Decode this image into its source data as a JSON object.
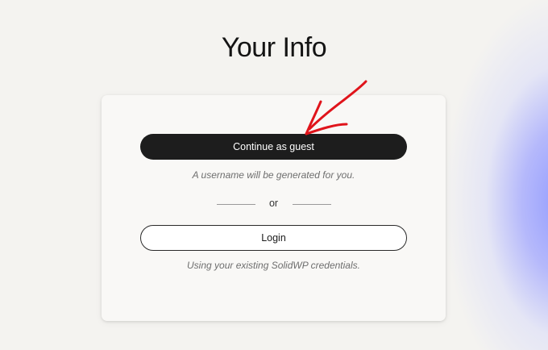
{
  "page": {
    "title": "Your Info"
  },
  "card": {
    "guest_button_label": "Continue as guest",
    "guest_note": "A username will be generated for you.",
    "divider_text": "or",
    "login_button_label": "Login",
    "login_note": "Using your existing SolidWP credentials."
  },
  "colors": {
    "primary_button_bg": "#1d1d1d",
    "annotation_arrow": "#e0141b",
    "glow": "#8c96ff"
  },
  "icons": {
    "annotation": "red-arrow-icon"
  }
}
